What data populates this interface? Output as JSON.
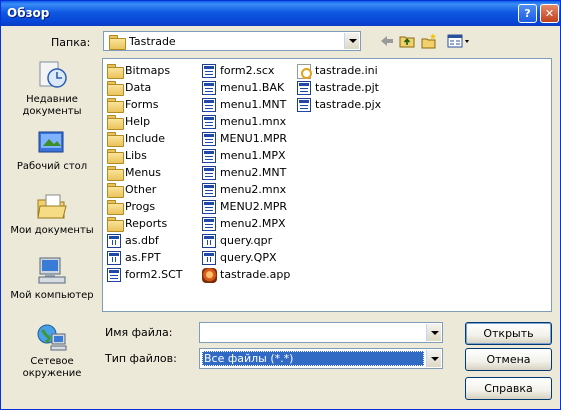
{
  "window": {
    "title": "Обзор"
  },
  "titlebar_buttons": {
    "help": "?",
    "close": "✕"
  },
  "lookin": {
    "label": "Папка:",
    "value": "Tastrade"
  },
  "places": [
    {
      "label": "Недавние документы",
      "icon": "recent-documents-icon"
    },
    {
      "label": "Рабочий стол",
      "icon": "desktop-icon"
    },
    {
      "label": "Мои документы",
      "icon": "my-documents-icon"
    },
    {
      "label": "Мой компьютер",
      "icon": "my-computer-icon"
    },
    {
      "label": "Сетевое окружение",
      "icon": "network-icon"
    }
  ],
  "files": {
    "col1": [
      {
        "name": "Bitmaps",
        "icon": "folder-icon"
      },
      {
        "name": "Data",
        "icon": "folder-icon"
      },
      {
        "name": "Forms",
        "icon": "folder-icon"
      },
      {
        "name": "Help",
        "icon": "folder-icon"
      },
      {
        "name": "Include",
        "icon": "folder-icon"
      },
      {
        "name": "Libs",
        "icon": "folder-icon"
      },
      {
        "name": "Menus",
        "icon": "folder-icon"
      },
      {
        "name": "Other",
        "icon": "folder-icon"
      },
      {
        "name": "Progs",
        "icon": "folder-icon"
      },
      {
        "name": "Reports",
        "icon": "folder-icon"
      },
      {
        "name": "as.dbf",
        "icon": "table-file-icon"
      },
      {
        "name": "as.FPT",
        "icon": "table-file-icon"
      },
      {
        "name": "form2.SCT",
        "icon": "form-file-icon"
      }
    ],
    "col2": [
      {
        "name": "form2.scx",
        "icon": "form-file-icon"
      },
      {
        "name": "menu1.BAK",
        "icon": "document-file-icon"
      },
      {
        "name": "menu1.MNT",
        "icon": "document-file-icon"
      },
      {
        "name": "menu1.mnx",
        "icon": "document-file-icon"
      },
      {
        "name": "MENU1.MPR",
        "icon": "document-file-icon"
      },
      {
        "name": "menu1.MPX",
        "icon": "document-file-icon"
      },
      {
        "name": "menu2.MNT",
        "icon": "document-file-icon"
      },
      {
        "name": "menu2.mnx",
        "icon": "document-file-icon"
      },
      {
        "name": "MENU2.MPR",
        "icon": "document-file-icon"
      },
      {
        "name": "menu2.MPX",
        "icon": "document-file-icon"
      },
      {
        "name": "query.qpr",
        "icon": "query-file-icon"
      },
      {
        "name": "query.QPX",
        "icon": "query-file-icon"
      },
      {
        "name": "tastrade.app",
        "icon": "application-file-icon"
      }
    ],
    "col3": [
      {
        "name": "tastrade.ini",
        "icon": "settings-file-icon"
      },
      {
        "name": "tastrade.pjt",
        "icon": "project-file-icon"
      },
      {
        "name": "tastrade.pjx",
        "icon": "project-file-icon"
      }
    ]
  },
  "filename": {
    "label": "Имя файла:",
    "value": ""
  },
  "filetype": {
    "label": "Тип файлов:",
    "value": "Все файлы (*.*)"
  },
  "buttons": {
    "open": "Открыть",
    "cancel": "Отмена",
    "help": "Справка"
  }
}
